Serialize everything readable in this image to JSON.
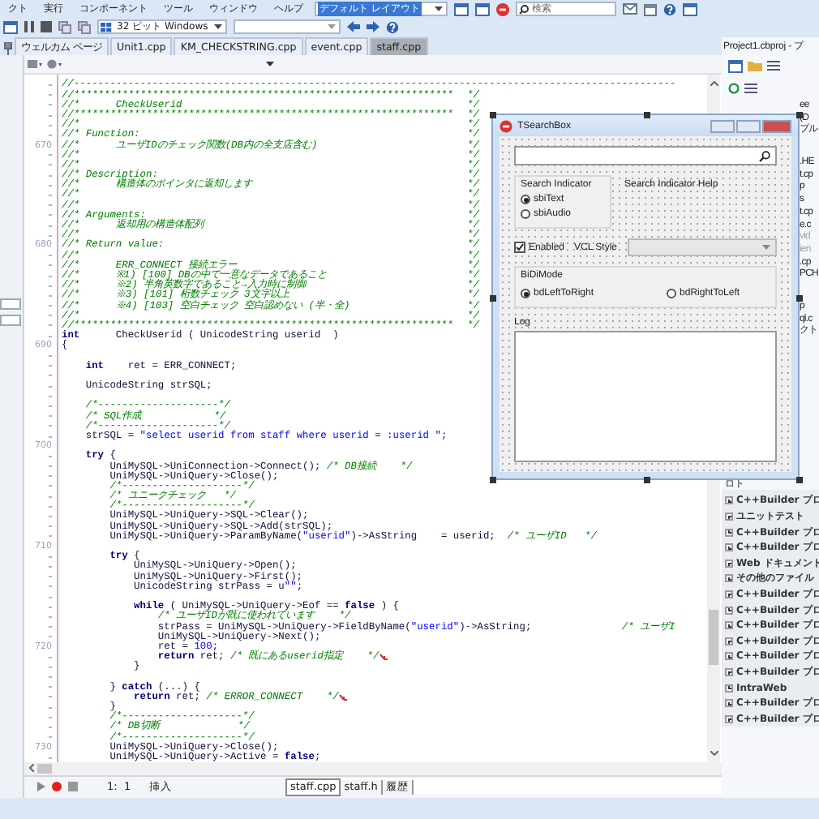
{
  "menu": [
    "クト",
    "実行",
    "コンポーネント",
    "ツール",
    "ウィンドウ",
    "ヘルプ"
  ],
  "layout_combo": {
    "value": "デフォルト レイアウト"
  },
  "search": {
    "placeholder": "検索"
  },
  "platform_combo": {
    "value": "32 ビット Windows"
  },
  "tabs": [
    {
      "label": "ウェルカム ページ",
      "selected": false
    },
    {
      "label": "Unit1.cpp",
      "selected": false
    },
    {
      "label": "KM_CHECKSTRING.cpp",
      "selected": false
    },
    {
      "label": "event.cpp",
      "selected": false
    },
    {
      "label": "staff.cpp",
      "selected": true
    }
  ],
  "panel_title": "Project1.cbproj - プ",
  "editor": {
    "lines": [
      {
        "kind": "code",
        "segments": [
          {
            "kind": "comment",
            "text": "//----------------------------------------------------------------------------------------------------"
          }
        ]
      },
      {
        "kind": "code",
        "segments": [
          {
            "kind": "comment",
            "text": "//***************************************************************"
          }
        ],
        "end": "*/"
      },
      {
        "kind": "code",
        "segments": [
          {
            "kind": "comment",
            "text": "//*      CheckUserid"
          }
        ],
        "end": "*/"
      },
      {
        "kind": "code",
        "segments": [
          {
            "kind": "comment",
            "text": "//***************************************************************"
          }
        ],
        "end": "*/"
      },
      {
        "kind": "code",
        "segments": [
          {
            "kind": "comment",
            "text": "//*"
          }
        ],
        "end": "*/"
      },
      {
        "kind": "code",
        "segments": [
          {
            "kind": "comment",
            "text": "//* Function:"
          }
        ],
        "end": "*/"
      },
      {
        "kind": "code",
        "num": "670",
        "segments": [
          {
            "kind": "comment",
            "text": "//*      ユーザIDのチェック関数(DB内の全支店含む)"
          }
        ],
        "end": "*/"
      },
      {
        "kind": "code",
        "segments": [
          {
            "kind": "comment",
            "text": "//*"
          }
        ],
        "end": "*/"
      },
      {
        "kind": "code",
        "segments": [
          {
            "kind": "comment",
            "text": "//*"
          }
        ],
        "end": "*/"
      },
      {
        "kind": "code",
        "segments": [
          {
            "kind": "comment",
            "text": "//* Description:"
          }
        ],
        "end": "*/"
      },
      {
        "kind": "code",
        "segments": [
          {
            "kind": "comment",
            "text": "//*      構造体のポインタに返却します"
          }
        ],
        "end": "*/"
      },
      {
        "kind": "code",
        "segments": [
          {
            "kind": "comment",
            "text": "//*"
          }
        ],
        "end": "*/"
      },
      {
        "kind": "code",
        "segments": [
          {
            "kind": "comment",
            "text": "//*"
          }
        ],
        "end": "*/"
      },
      {
        "kind": "code",
        "segments": [
          {
            "kind": "comment",
            "text": "//* Arguments:"
          }
        ],
        "end": "*/"
      },
      {
        "kind": "code",
        "segments": [
          {
            "kind": "comment",
            "text": "//*      返却用の構造体配列"
          }
        ],
        "end": "*/"
      },
      {
        "kind": "code",
        "segments": [
          {
            "kind": "comment",
            "text": "//*"
          }
        ],
        "end": "*/"
      },
      {
        "kind": "code",
        "num": "680",
        "segments": [
          {
            "kind": "comment",
            "text": "//* Return value:"
          }
        ],
        "end": "*/"
      },
      {
        "kind": "code",
        "segments": [
          {
            "kind": "comment",
            "text": "//*"
          }
        ],
        "end": "*/"
      },
      {
        "kind": "code",
        "segments": [
          {
            "kind": "comment",
            "text": "//*      ERR_CONNECT 接続エラー"
          }
        ],
        "end": "*/"
      },
      {
        "kind": "code",
        "segments": [
          {
            "kind": "comment",
            "text": "//*      ※1) [100] DBの中で一意なデータであること"
          }
        ],
        "end": "*/"
      },
      {
        "kind": "code",
        "segments": [
          {
            "kind": "comment",
            "text": "//*      ※2) 半角英数字であること→入力時に制御"
          }
        ],
        "end": "*/"
      },
      {
        "kind": "code",
        "segments": [
          {
            "kind": "comment",
            "text": "//*      ※3) [101] 桁数チェック 3文字以上"
          }
        ],
        "end": "*/"
      },
      {
        "kind": "code",
        "segments": [
          {
            "kind": "comment",
            "text": "//*      ※4) [103] 空白チェック 空白認めない (半・全)"
          }
        ],
        "end": "*/"
      },
      {
        "kind": "code",
        "segments": [
          {
            "kind": "comment",
            "text": "//*"
          }
        ],
        "end": "*/"
      },
      {
        "kind": "code",
        "segments": [
          {
            "kind": "comment",
            "text": "//***************************************************************"
          }
        ],
        "end": "*/"
      },
      {
        "kind": "code",
        "segments": [
          {
            "kind": "keyword",
            "text": "int"
          },
          {
            "kind": "plain",
            "text": "      CheckUserid ( UnicodeString userid  )"
          }
        ]
      },
      {
        "kind": "code",
        "num": "690",
        "segments": [
          {
            "kind": "plain",
            "text": "{"
          }
        ]
      },
      {
        "kind": "blank"
      },
      {
        "kind": "code",
        "segments": [
          {
            "kind": "keyword",
            "text": "    int"
          },
          {
            "kind": "plain",
            "text": "    ret = ERR_CONNECT;"
          }
        ]
      },
      {
        "kind": "blank"
      },
      {
        "kind": "code",
        "segments": [
          {
            "kind": "plain",
            "text": "    UnicodeString strSQL;"
          }
        ]
      },
      {
        "kind": "blank"
      },
      {
        "kind": "code",
        "segments": [
          {
            "kind": "comment",
            "text": "    /*--------------------*/"
          }
        ]
      },
      {
        "kind": "code",
        "segments": [
          {
            "kind": "comment",
            "text": "    /* SQL作成            */"
          }
        ]
      },
      {
        "kind": "code",
        "segments": [
          {
            "kind": "comment",
            "text": "    /*--------------------*/"
          }
        ]
      },
      {
        "kind": "code",
        "segments": [
          {
            "kind": "plain",
            "text": "    strSQL = "
          },
          {
            "kind": "string",
            "text": "\"select userid from staff where userid = :userid \""
          },
          {
            "kind": "plain",
            "text": ";"
          }
        ]
      },
      {
        "kind": "blank",
        "num": "700"
      },
      {
        "kind": "code",
        "segments": [
          {
            "kind": "keyword",
            "text": "    try"
          },
          {
            "kind": "plain",
            "text": " {"
          }
        ]
      },
      {
        "kind": "code",
        "segments": [
          {
            "kind": "plain",
            "text": "        UniMySQL->UniConnection->Connect(); "
          },
          {
            "kind": "comment",
            "text": "/* DB接続    */"
          }
        ]
      },
      {
        "kind": "code",
        "segments": [
          {
            "kind": "plain",
            "text": "        UniMySQL->UniQuery->Close();"
          }
        ]
      },
      {
        "kind": "code",
        "segments": [
          {
            "kind": "comment",
            "text": "        /*--------------------*/"
          }
        ]
      },
      {
        "kind": "code",
        "segments": [
          {
            "kind": "comment",
            "text": "        /* ユニークチェック   */"
          }
        ]
      },
      {
        "kind": "code",
        "segments": [
          {
            "kind": "comment",
            "text": "        /*--------------------*/"
          }
        ]
      },
      {
        "kind": "code",
        "segments": [
          {
            "kind": "plain",
            "text": "        UniMySQL->UniQuery->SQL->Clear();"
          }
        ]
      },
      {
        "kind": "code",
        "segments": [
          {
            "kind": "plain",
            "text": "        UniMySQL->UniQuery->SQL->Add(strSQL);"
          }
        ]
      },
      {
        "kind": "code",
        "segments": [
          {
            "kind": "plain",
            "text": "        UniMySQL->UniQuery->ParamByName("
          },
          {
            "kind": "string",
            "text": "\"userid\""
          },
          {
            "kind": "plain",
            "text": ")->AsString    = userid;  "
          },
          {
            "kind": "comment",
            "text": "/* ユーザID   */"
          }
        ]
      },
      {
        "kind": "blank",
        "num": "710"
      },
      {
        "kind": "code",
        "segments": [
          {
            "kind": "keyword",
            "text": "        try"
          },
          {
            "kind": "plain",
            "text": " {"
          }
        ]
      },
      {
        "kind": "code",
        "segments": [
          {
            "kind": "plain",
            "text": "            UniMySQL->UniQuery->Open();"
          }
        ]
      },
      {
        "kind": "code",
        "segments": [
          {
            "kind": "plain",
            "text": "            UniMySQL->UniQuery->First();"
          }
        ]
      },
      {
        "kind": "code",
        "segments": [
          {
            "kind": "plain",
            "text": "            UnicodeString strPass = u"
          },
          {
            "kind": "string",
            "text": "\"\""
          },
          {
            "kind": "plain",
            "text": ";"
          }
        ]
      },
      {
        "kind": "blank"
      },
      {
        "kind": "code",
        "segments": [
          {
            "kind": "keyword",
            "text": "            while"
          },
          {
            "kind": "plain",
            "text": " ( UniMySQL->UniQuery->Eof == "
          },
          {
            "kind": "keyword",
            "text": "false"
          },
          {
            "kind": "plain",
            "text": " ) {"
          }
        ]
      },
      {
        "kind": "code",
        "segments": [
          {
            "kind": "comment",
            "text": "                /* ユーザIDが既に使われています    */"
          }
        ]
      },
      {
        "kind": "code",
        "segments": [
          {
            "kind": "plain",
            "text": "                strPass = UniMySQL->UniQuery->FieldByName("
          },
          {
            "kind": "string",
            "text": "\"userid\""
          },
          {
            "kind": "plain",
            "text": ")->AsString;               "
          },
          {
            "kind": "comment",
            "text": "/* ユーザI"
          }
        ]
      },
      {
        "kind": "code",
        "segments": [
          {
            "kind": "plain",
            "text": "                UniMySQL->UniQuery->Next();"
          }
        ]
      },
      {
        "kind": "code",
        "num": "720",
        "segments": [
          {
            "kind": "plain",
            "text": "                ret = "
          },
          {
            "kind": "number",
            "text": "100"
          },
          {
            "kind": "plain",
            "text": ";"
          }
        ]
      },
      {
        "kind": "code",
        "segments": [
          {
            "kind": "keyword",
            "text": "                return"
          },
          {
            "kind": "plain",
            "text": " ret; "
          },
          {
            "kind": "comment",
            "text": "/* 既にあるuserid指定    */"
          }
        ],
        "end_marker": true
      },
      {
        "kind": "code",
        "segments": [
          {
            "kind": "plain",
            "text": "            }"
          }
        ]
      },
      {
        "kind": "blank"
      },
      {
        "kind": "code",
        "segments": [
          {
            "kind": "plain",
            "text": "        } "
          },
          {
            "kind": "keyword",
            "text": "catch"
          },
          {
            "kind": "plain",
            "text": " (...) {"
          }
        ]
      },
      {
        "kind": "code",
        "segments": [
          {
            "kind": "keyword",
            "text": "            return"
          },
          {
            "kind": "plain",
            "text": " ret; "
          },
          {
            "kind": "comment",
            "text": "/* ERROR_CONNECT    */"
          }
        ],
        "end_marker": true
      },
      {
        "kind": "code",
        "segments": [
          {
            "kind": "plain",
            "text": "        }"
          }
        ]
      },
      {
        "kind": "code",
        "segments": [
          {
            "kind": "comment",
            "text": "        /*--------------------*/"
          }
        ]
      },
      {
        "kind": "code",
        "segments": [
          {
            "kind": "comment",
            "text": "        /* DB切断             */"
          }
        ]
      },
      {
        "kind": "code",
        "segments": [
          {
            "kind": "comment",
            "text": "        /*--------------------*/"
          }
        ]
      },
      {
        "kind": "code",
        "num": "730",
        "segments": [
          {
            "kind": "plain",
            "text": "        UniMySQL->UniQuery->Close();"
          }
        ]
      },
      {
        "kind": "code",
        "segments": [
          {
            "kind": "plain",
            "text": "        UniMySQL->UniQuery->Active = "
          },
          {
            "kind": "keyword",
            "text": "false"
          },
          {
            "kind": "plain",
            "text": ";"
          }
        ]
      }
    ]
  },
  "status": {
    "position": "1:  1",
    "mode": "挿入",
    "tabs": [
      {
        "label": "staff.cpp",
        "selected": true
      },
      {
        "label": "staff.h",
        "selected": false
      },
      {
        "label": "履歴",
        "selected": false
      }
    ]
  },
  "project_items": [
    [
      {
        "label": "ee",
        "disabled": false
      },
      {
        "label": "(D",
        "disabled": false
      },
      {
        "label": "プル",
        "disabled": false
      }
    ],
    [
      {
        "label": ".HE",
        "disabled": false
      },
      {
        "label": "t.cp",
        "disabled": false
      },
      {
        "label": "p",
        "disabled": false
      },
      {
        "label": "s",
        "disabled": false
      },
      {
        "label": "t.cp",
        "disabled": false
      },
      {
        "label": "e.c",
        "disabled": false
      },
      {
        "label": "vid",
        "disabled": true
      },
      {
        "label": "ien",
        "disabled": true
      },
      {
        "label": ".cp",
        "disabled": false
      },
      {
        "label": "PCH",
        "disabled": false
      }
    ],
    [
      {
        "label": "p",
        "disabled": false
      },
      {
        "label": "ql.c",
        "disabled": false
      },
      {
        "label": "クト",
        "disabled": false
      }
    ]
  ],
  "tree_heading": "ロト",
  "tree": [
    {
      "label": "C++Builder プロ",
      "expanded": false
    },
    {
      "label": "ユニットテスト",
      "expanded": false
    },
    {
      "label": "C++Builder プロ",
      "expanded": false
    },
    {
      "label": "C++Builder プロ",
      "expanded": false
    },
    {
      "label": "Web ドキュメント",
      "expanded": false
    },
    {
      "label": "その他のファイル",
      "expanded": false
    },
    {
      "label": "C++Builder プロ",
      "expanded": false
    },
    {
      "label": "C++Builder プロ",
      "expanded": false
    },
    {
      "label": "C++Builder プロ",
      "expanded": false
    },
    {
      "label": "C++Builder プロ",
      "expanded": false
    },
    {
      "label": "C++Builder プロ",
      "expanded": false
    },
    {
      "label": "C++Builder プロ",
      "expanded": false
    },
    {
      "label": "IntraWeb",
      "expanded": false
    },
    {
      "label": "C++Builder プロ",
      "expanded": false
    },
    {
      "label": "C++Builder プロ",
      "expanded": false
    }
  ],
  "form": {
    "title": "TSearchBox",
    "indicator_group": {
      "title": "Search Indicator",
      "options": [
        {
          "label": "sbiText",
          "selected": true
        },
        {
          "label": "sbiAudio",
          "selected": false
        }
      ]
    },
    "help_label": "Search Indicator Help",
    "enabled": {
      "label": "Enabled",
      "checked": true
    },
    "style_label": "VCL Style",
    "style_combo": {
      "disabled": true
    },
    "bidi_group": {
      "title": "BiDiMode",
      "options": [
        {
          "label": "bdLeftToRight",
          "selected": true
        },
        {
          "label": "bdRightToLeft",
          "selected": false
        }
      ]
    },
    "log_label": "Log"
  }
}
